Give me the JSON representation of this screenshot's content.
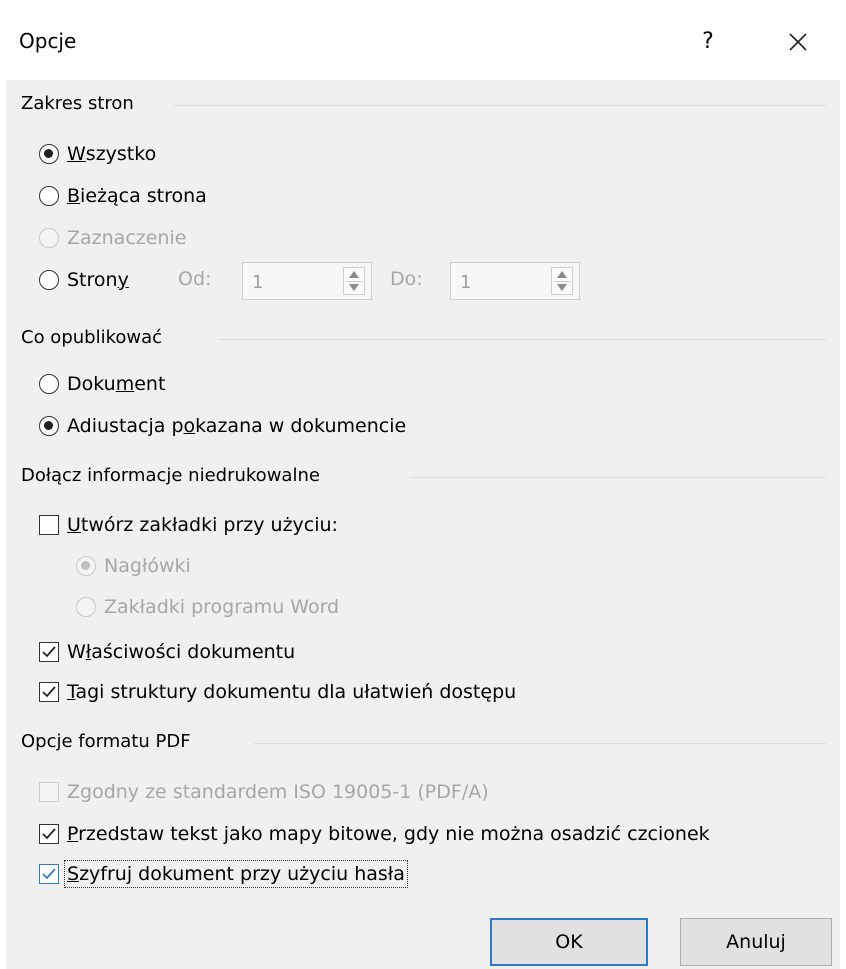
{
  "dialog": {
    "title": "Opcje",
    "help_label": "?",
    "close_icon": "close-icon"
  },
  "page_range": {
    "header": "Zakres stron",
    "all": {
      "prefix": "",
      "mnemonic": "W",
      "suffix": "szystko",
      "checked": true
    },
    "current": {
      "prefix": "",
      "mnemonic": "B",
      "suffix": "ieżąca strona",
      "checked": false
    },
    "selection": {
      "label": "Zaznaczenie",
      "disabled": true
    },
    "pages": {
      "prefix": "Stron",
      "mnemonic": "y",
      "suffix": "",
      "checked": false
    },
    "from_label": "Od:",
    "from_value": "1",
    "to_label": "Do:",
    "to_value": "1"
  },
  "publish": {
    "header": "Co opublikować",
    "document": {
      "prefix": "Doku",
      "mnemonic": "m",
      "suffix": "ent",
      "checked": false
    },
    "markup": {
      "prefix": "Adiustacja p",
      "mnemonic": "o",
      "suffix": "kazana w dokumencie",
      "checked": true
    }
  },
  "nonprint": {
    "header": "Dołącz informacje niedrukowalne",
    "bookmarks": {
      "prefix": "",
      "mnemonic": "U",
      "suffix": "twórz zakładki przy użyciu:",
      "checked": false
    },
    "headings": {
      "label": "Nagłówki",
      "checked": true,
      "disabled": true
    },
    "word_bookmarks": {
      "label": "Zakładki programu Word",
      "checked": false,
      "disabled": true
    },
    "properties": {
      "prefix": "W",
      "mnemonic": "ł",
      "suffix": "aściwości dokumentu",
      "checked": true
    },
    "tags": {
      "prefix": "",
      "mnemonic": "T",
      "suffix": "agi struktury dokumentu dla ułatwień dostępu",
      "checked": true
    }
  },
  "pdf": {
    "header": "Opcje formatu PDF",
    "iso": {
      "label": "Zgodny ze standardem ISO 19005-1 (PDF/A)",
      "checked": false,
      "disabled": true
    },
    "bitmap": {
      "prefix": "",
      "mnemonic": "P",
      "suffix": "rzedstaw tekst jako mapy bitowe, gdy nie można osadzić czcionek",
      "checked": true
    },
    "encrypt": {
      "prefix": "",
      "mnemonic": "S",
      "suffix": "zyfruj dokument przy użyciu hasła",
      "checked": true
    }
  },
  "buttons": {
    "ok": "OK",
    "cancel": "Anuluj"
  },
  "colors": {
    "accent": "#2e79c7",
    "panel": "#f0f0f0",
    "disabled_text": "#a6a6a6"
  }
}
